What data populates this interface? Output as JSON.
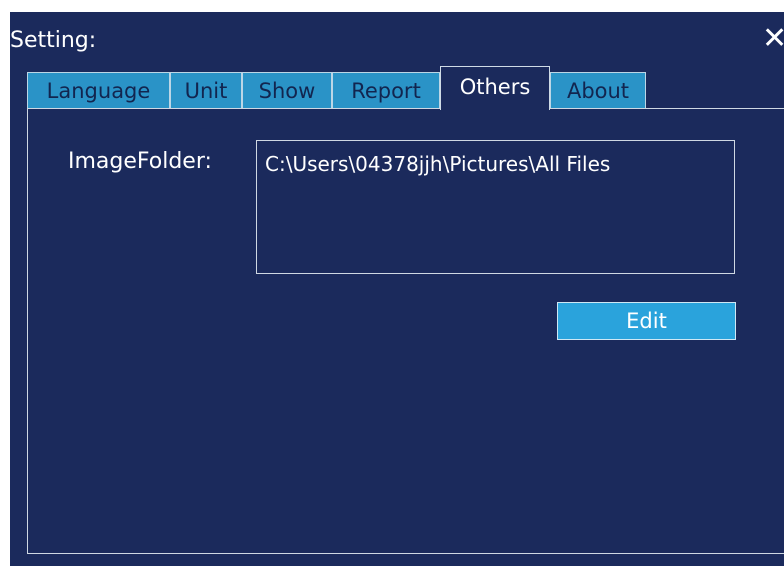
{
  "window": {
    "title": "Setting:",
    "close_label": "✕"
  },
  "tabs": [
    {
      "label": "Language",
      "active": false
    },
    {
      "label": "Unit",
      "active": false
    },
    {
      "label": "Show",
      "active": false
    },
    {
      "label": "Report",
      "active": false
    },
    {
      "label": "Others",
      "active": true
    },
    {
      "label": "About",
      "active": false
    }
  ],
  "others": {
    "image_folder_label": "ImageFolder:",
    "image_folder_value": "C:\\Users\\04378jjh\\Pictures\\All Files",
    "edit_label": "Edit"
  },
  "colors": {
    "background": "#1b2a5c",
    "tab": "#2a93c7",
    "button": "#2aa3dc",
    "text": "#ffffff"
  }
}
